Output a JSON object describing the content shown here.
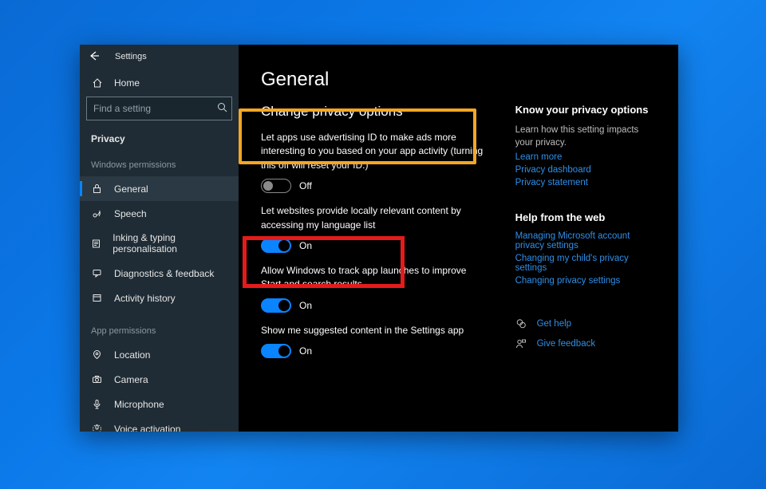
{
  "app": {
    "title": "Settings"
  },
  "sidebar": {
    "home": "Home",
    "search_placeholder": "Find a setting",
    "crumb": "Privacy",
    "section_win": "Windows permissions",
    "items_win": [
      {
        "label": "General"
      },
      {
        "label": "Speech"
      },
      {
        "label": "Inking & typing personalisation"
      },
      {
        "label": "Diagnostics & feedback"
      },
      {
        "label": "Activity history"
      }
    ],
    "section_app": "App permissions",
    "items_app": [
      {
        "label": "Location"
      },
      {
        "label": "Camera"
      },
      {
        "label": "Microphone"
      },
      {
        "label": "Voice activation"
      }
    ]
  },
  "page": {
    "title": "General",
    "section": "Change privacy options",
    "settings": [
      {
        "label": "Let apps use advertising ID to make ads more interesting to you based on your app activity (turning this off will reset your ID.)",
        "state": "Off"
      },
      {
        "label": "Let websites provide locally relevant content by accessing my language list",
        "state": "On"
      },
      {
        "label": "Allow Windows to track app launches to improve Start and search results",
        "state": "On"
      },
      {
        "label": "Show me suggested content in the Settings app",
        "state": "On"
      }
    ]
  },
  "right": {
    "know_h": "Know your privacy options",
    "know_text": "Learn how this setting impacts your privacy.",
    "links1": [
      "Learn more",
      "Privacy dashboard",
      "Privacy statement"
    ],
    "help_h": "Help from the web",
    "links2": [
      "Managing Microsoft account privacy settings",
      "Changing my child's privacy settings",
      "Changing privacy settings"
    ],
    "get_help": "Get help",
    "give_feedback": "Give feedback"
  }
}
